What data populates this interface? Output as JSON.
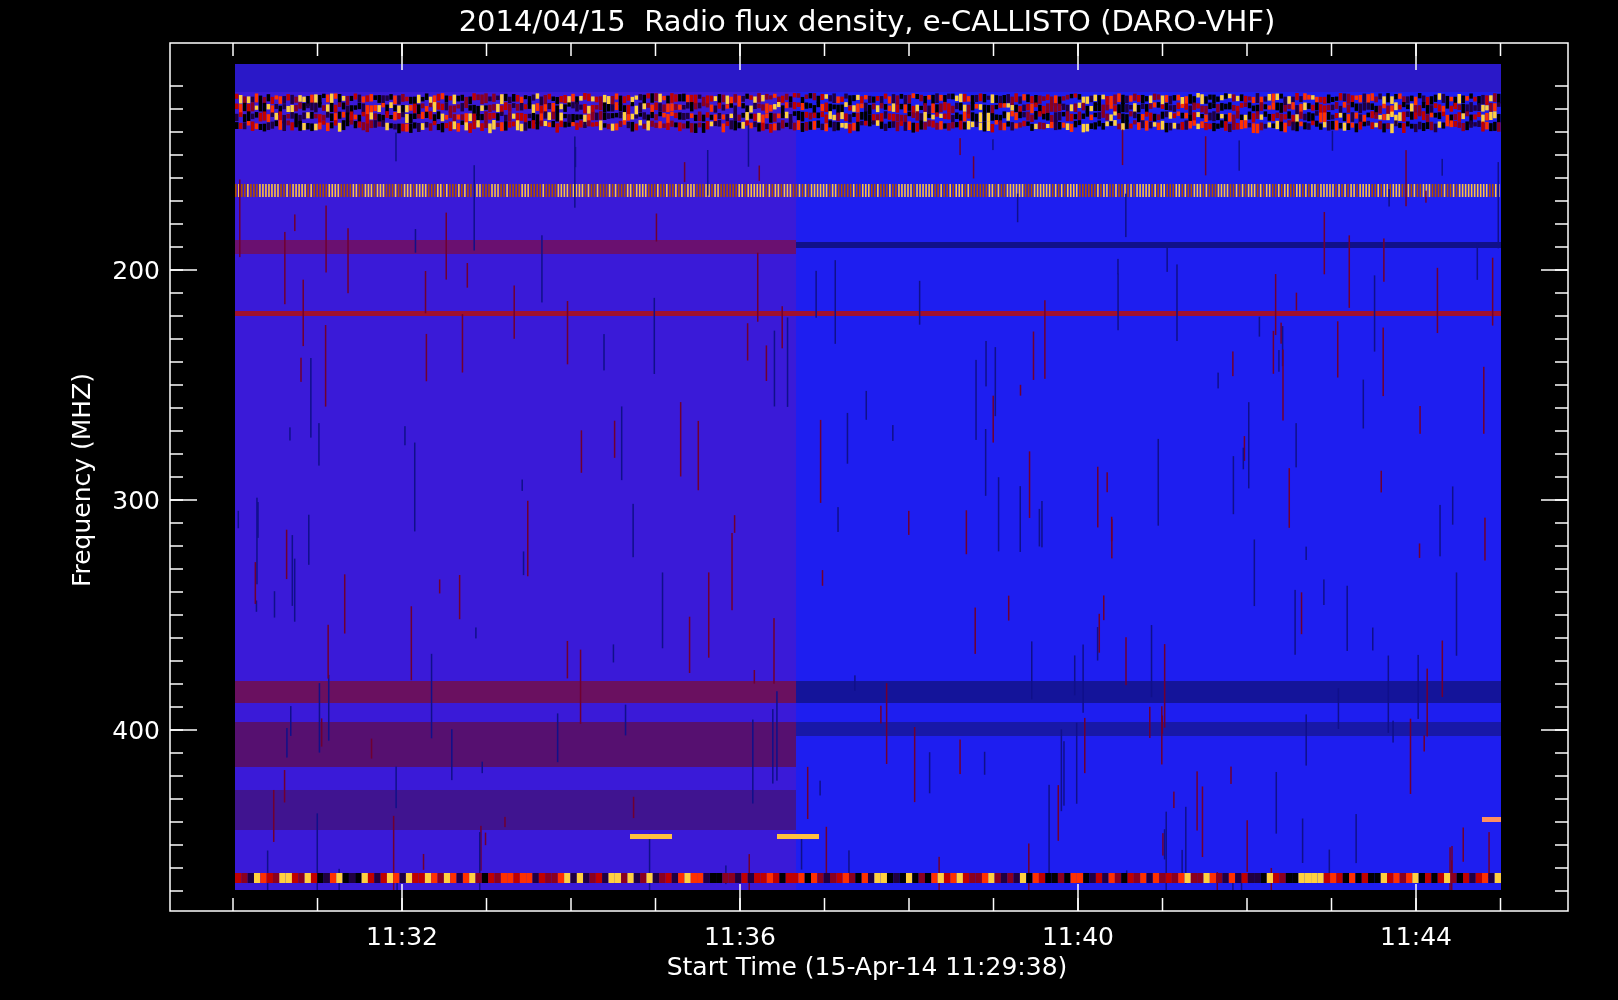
{
  "title": "2014/04/15  Radio flux density, e-CALLISTO (DARO-VHF)",
  "y_axis": {
    "label": "Frequency (MHZ)",
    "ticks": [
      "200",
      "300",
      "400"
    ]
  },
  "x_axis": {
    "label": "Start Time (15-Apr-14 11:29:38)",
    "ticks": [
      "11:32",
      "11:36",
      "11:40",
      "11:44"
    ]
  }
}
